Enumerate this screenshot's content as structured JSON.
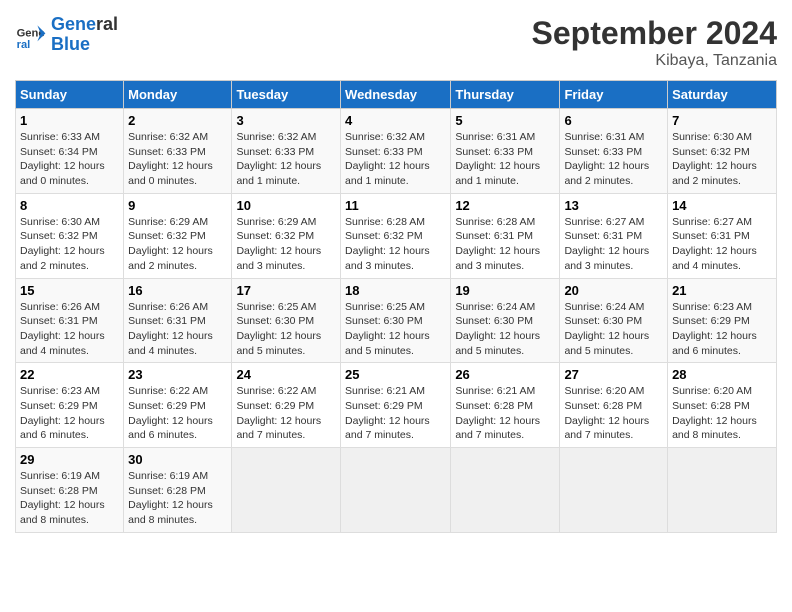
{
  "logo": {
    "line1": "General",
    "line2": "Blue"
  },
  "title": "September 2024",
  "location": "Kibaya, Tanzania",
  "days_of_week": [
    "Sunday",
    "Monday",
    "Tuesday",
    "Wednesday",
    "Thursday",
    "Friday",
    "Saturday"
  ],
  "weeks": [
    [
      {
        "day": "1",
        "sunrise": "6:33 AM",
        "sunset": "6:34 PM",
        "daylight": "12 hours and 0 minutes."
      },
      {
        "day": "2",
        "sunrise": "6:32 AM",
        "sunset": "6:33 PM",
        "daylight": "12 hours and 0 minutes."
      },
      {
        "day": "3",
        "sunrise": "6:32 AM",
        "sunset": "6:33 PM",
        "daylight": "12 hours and 1 minute."
      },
      {
        "day": "4",
        "sunrise": "6:32 AM",
        "sunset": "6:33 PM",
        "daylight": "12 hours and 1 minute."
      },
      {
        "day": "5",
        "sunrise": "6:31 AM",
        "sunset": "6:33 PM",
        "daylight": "12 hours and 1 minute."
      },
      {
        "day": "6",
        "sunrise": "6:31 AM",
        "sunset": "6:33 PM",
        "daylight": "12 hours and 2 minutes."
      },
      {
        "day": "7",
        "sunrise": "6:30 AM",
        "sunset": "6:32 PM",
        "daylight": "12 hours and 2 minutes."
      }
    ],
    [
      {
        "day": "8",
        "sunrise": "6:30 AM",
        "sunset": "6:32 PM",
        "daylight": "12 hours and 2 minutes."
      },
      {
        "day": "9",
        "sunrise": "6:29 AM",
        "sunset": "6:32 PM",
        "daylight": "12 hours and 2 minutes."
      },
      {
        "day": "10",
        "sunrise": "6:29 AM",
        "sunset": "6:32 PM",
        "daylight": "12 hours and 3 minutes."
      },
      {
        "day": "11",
        "sunrise": "6:28 AM",
        "sunset": "6:32 PM",
        "daylight": "12 hours and 3 minutes."
      },
      {
        "day": "12",
        "sunrise": "6:28 AM",
        "sunset": "6:31 PM",
        "daylight": "12 hours and 3 minutes."
      },
      {
        "day": "13",
        "sunrise": "6:27 AM",
        "sunset": "6:31 PM",
        "daylight": "12 hours and 3 minutes."
      },
      {
        "day": "14",
        "sunrise": "6:27 AM",
        "sunset": "6:31 PM",
        "daylight": "12 hours and 4 minutes."
      }
    ],
    [
      {
        "day": "15",
        "sunrise": "6:26 AM",
        "sunset": "6:31 PM",
        "daylight": "12 hours and 4 minutes."
      },
      {
        "day": "16",
        "sunrise": "6:26 AM",
        "sunset": "6:31 PM",
        "daylight": "12 hours and 4 minutes."
      },
      {
        "day": "17",
        "sunrise": "6:25 AM",
        "sunset": "6:30 PM",
        "daylight": "12 hours and 5 minutes."
      },
      {
        "day": "18",
        "sunrise": "6:25 AM",
        "sunset": "6:30 PM",
        "daylight": "12 hours and 5 minutes."
      },
      {
        "day": "19",
        "sunrise": "6:24 AM",
        "sunset": "6:30 PM",
        "daylight": "12 hours and 5 minutes."
      },
      {
        "day": "20",
        "sunrise": "6:24 AM",
        "sunset": "6:30 PM",
        "daylight": "12 hours and 5 minutes."
      },
      {
        "day": "21",
        "sunrise": "6:23 AM",
        "sunset": "6:29 PM",
        "daylight": "12 hours and 6 minutes."
      }
    ],
    [
      {
        "day": "22",
        "sunrise": "6:23 AM",
        "sunset": "6:29 PM",
        "daylight": "12 hours and 6 minutes."
      },
      {
        "day": "23",
        "sunrise": "6:22 AM",
        "sunset": "6:29 PM",
        "daylight": "12 hours and 6 minutes."
      },
      {
        "day": "24",
        "sunrise": "6:22 AM",
        "sunset": "6:29 PM",
        "daylight": "12 hours and 7 minutes."
      },
      {
        "day": "25",
        "sunrise": "6:21 AM",
        "sunset": "6:29 PM",
        "daylight": "12 hours and 7 minutes."
      },
      {
        "day": "26",
        "sunrise": "6:21 AM",
        "sunset": "6:28 PM",
        "daylight": "12 hours and 7 minutes."
      },
      {
        "day": "27",
        "sunrise": "6:20 AM",
        "sunset": "6:28 PM",
        "daylight": "12 hours and 7 minutes."
      },
      {
        "day": "28",
        "sunrise": "6:20 AM",
        "sunset": "6:28 PM",
        "daylight": "12 hours and 8 minutes."
      }
    ],
    [
      {
        "day": "29",
        "sunrise": "6:19 AM",
        "sunset": "6:28 PM",
        "daylight": "12 hours and 8 minutes."
      },
      {
        "day": "30",
        "sunrise": "6:19 AM",
        "sunset": "6:28 PM",
        "daylight": "12 hours and 8 minutes."
      },
      null,
      null,
      null,
      null,
      null
    ]
  ]
}
